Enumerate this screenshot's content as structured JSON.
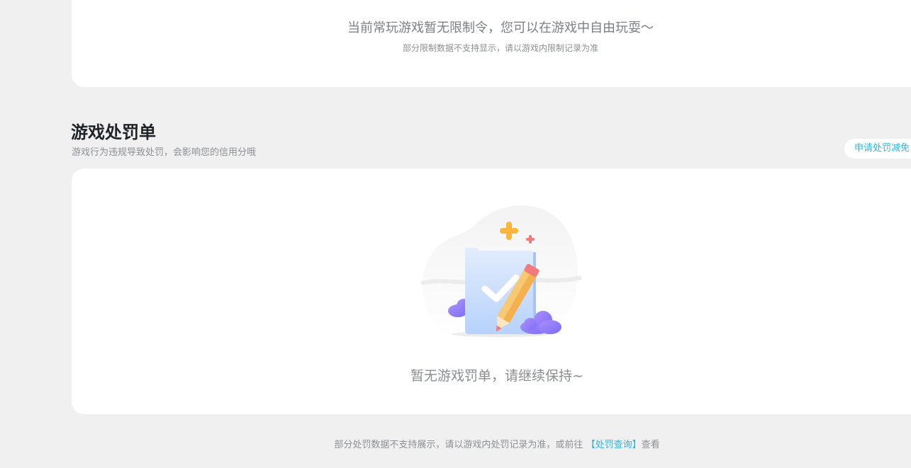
{
  "restriction": {
    "notice": "当前常玩游戏暂无限制令，您可以在游戏中自由玩耍～",
    "subnote": "部分限制数据不支持显示，请以游戏内限制记录为准"
  },
  "penalty": {
    "title": "游戏处罚单",
    "description": "游戏行为违规导致处罚，会影响您的信用分哦",
    "appeal_button": "申请处罚减免",
    "empty_text": "暂无游戏罚单，请继续保持~"
  },
  "footer": {
    "prefix": "部分处罚数据不支持展示，请以游戏内处罚记录为准，或前往",
    "link": "【处罚查询】",
    "suffix": "查看"
  },
  "colors": {
    "accent": "#2eb6e0",
    "background": "#f0f0f0",
    "card": "#ffffff"
  }
}
